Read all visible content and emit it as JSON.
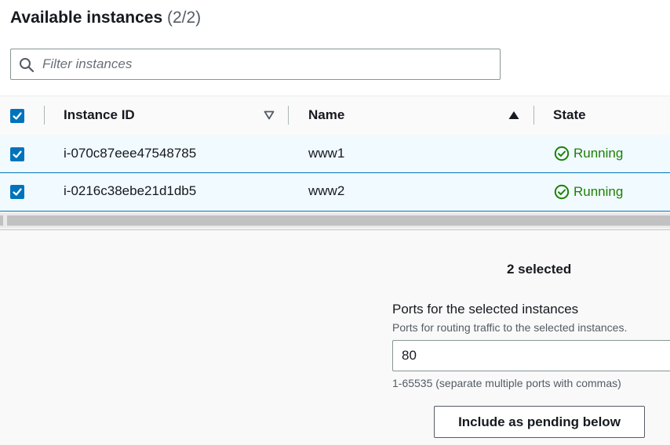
{
  "header": {
    "title": "Available instances",
    "count": "(2/2)"
  },
  "search": {
    "placeholder": "Filter instances",
    "value": ""
  },
  "table": {
    "columns": [
      {
        "label": "Instance ID",
        "sort": "descending-outline"
      },
      {
        "label": "Name",
        "sort": "ascending-active"
      },
      {
        "label": "State",
        "sort": "none"
      }
    ],
    "rows": [
      {
        "checked": true,
        "instance_id": "i-070c87eee47548785",
        "name": "www1",
        "state": "Running"
      },
      {
        "checked": true,
        "instance_id": "i-0216c38ebe21d1db5",
        "name": "www2",
        "state": "Running"
      }
    ]
  },
  "selection": {
    "summary": "2 selected"
  },
  "ports": {
    "label": "Ports for the selected instances",
    "description": "Ports for routing traffic to the selected instances.",
    "value": "80",
    "hint": "1-65535 (separate multiple ports with commas)"
  },
  "actions": {
    "include_pending": "Include as pending below"
  },
  "colors": {
    "accent": "#0073bb",
    "running": "#1d8102",
    "selected_row_bg": "#f1faff"
  },
  "icons": {
    "search": "search-icon",
    "checkbox": "checkmark-icon",
    "sort_desc": "caret-down-outline-icon",
    "sort_asc": "caret-up-filled-icon",
    "status": "check-circle-icon"
  }
}
